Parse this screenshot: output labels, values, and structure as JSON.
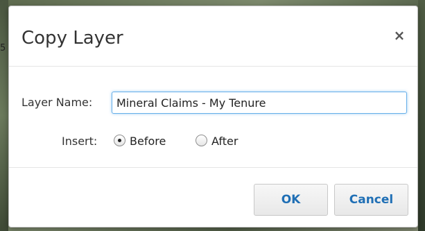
{
  "background": {
    "edge_text": "5"
  },
  "dialog": {
    "title": "Copy Layer",
    "close_glyph": "×",
    "fields": {
      "layer_name_label": "Layer Name:",
      "layer_name_value": "Mineral Claims - My Tenure",
      "insert_label": "Insert:",
      "insert_options": [
        {
          "label": "Before",
          "checked": true
        },
        {
          "label": "After",
          "checked": false
        }
      ]
    },
    "buttons": {
      "ok_label": "OK",
      "cancel_label": "Cancel"
    }
  },
  "colors": {
    "accent": "#1f6fb5",
    "focus_border": "#66afe9"
  },
  "icons": {
    "close": "close-icon",
    "radio_checked": "radio-checked",
    "radio_unchecked": "radio-unchecked"
  }
}
